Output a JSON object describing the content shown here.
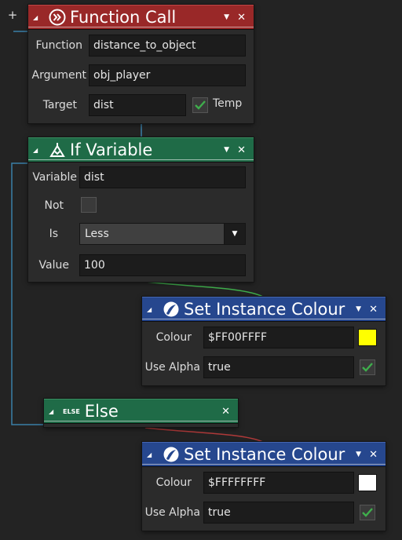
{
  "toolbar": {
    "add_label": "+"
  },
  "function_call": {
    "title": "Function Call",
    "color": "#992828",
    "icon": "function-call-icon",
    "rows": {
      "function": {
        "label": "Function",
        "value": "distance_to_object"
      },
      "argument": {
        "label": "Argument",
        "value": "obj_player"
      },
      "target": {
        "label": "Target",
        "value": "dist",
        "temp_label": "Temp",
        "temp_checked": true
      }
    }
  },
  "if_variable": {
    "title": "If Variable",
    "color": "#1f6b47",
    "icon": "if-variable-icon",
    "rows": {
      "variable": {
        "label": "Variable",
        "value": "dist"
      },
      "not": {
        "label": "Not",
        "checked": false
      },
      "is": {
        "label": "Is",
        "value": "Less"
      },
      "value": {
        "label": "Value",
        "value": "100"
      }
    }
  },
  "set_colour_1": {
    "title": "Set Instance Colour",
    "color": "#26478e",
    "icon": "paint-brush-icon",
    "rows": {
      "colour": {
        "label": "Colour",
        "value": "$FF00FFFF",
        "swatch": "#ffff00"
      },
      "use_alpha": {
        "label": "Use Alpha",
        "value": "true",
        "checked": true
      }
    }
  },
  "else_block": {
    "title": "Else",
    "badge": "ELSE",
    "color": "#1f6b47"
  },
  "set_colour_2": {
    "title": "Set Instance Colour",
    "color": "#26478e",
    "icon": "paint-brush-icon",
    "rows": {
      "colour": {
        "label": "Colour",
        "value": "$FFFFFFFF",
        "swatch": "#ffffff"
      },
      "use_alpha": {
        "label": "Use Alpha",
        "value": "true",
        "checked": true
      }
    }
  },
  "connectors": {
    "flow": "#3a7fa8",
    "true_branch": "#3fae4c",
    "false_branch": "#b03a3a"
  }
}
